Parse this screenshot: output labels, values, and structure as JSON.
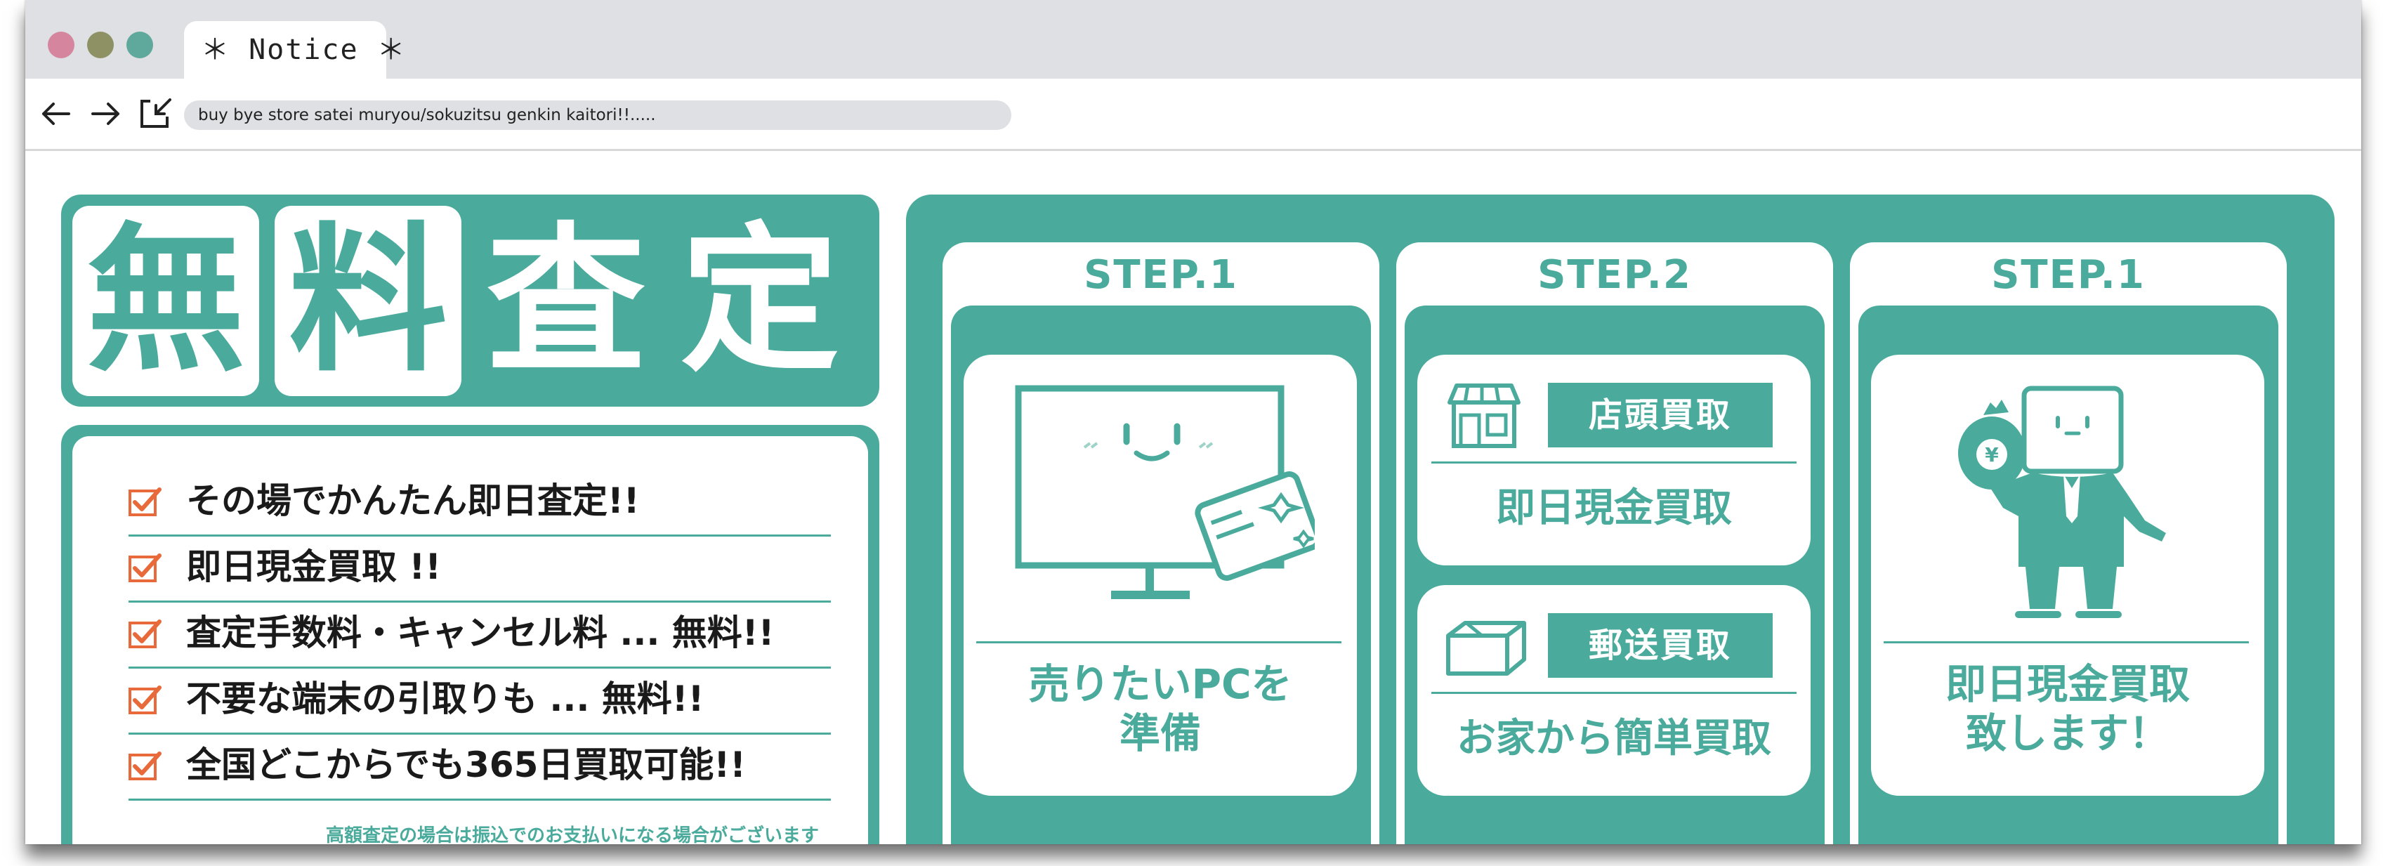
{
  "browser": {
    "tab_title": "＊ Notice ＊",
    "url": "buy bye store satei muryou/sokuzitsu genkin kaitori!!.....",
    "window_dots": [
      "#d5869e",
      "#8d9164",
      "#5fa89c"
    ]
  },
  "colors": {
    "accent": "#4aab9c",
    "check": "#e86a3a",
    "text": "#1a1a1a"
  },
  "hero": {
    "chars": [
      "無",
      "料",
      "査",
      "定"
    ]
  },
  "features": {
    "items": [
      "その場でかんたん即日査定!!",
      "即日現金買取 !!",
      "査定手数料・キャンセル料 ... 無料!!",
      "不要な端末の引取りも ... 無料!!",
      "全国どこからでも365日買取可能!!"
    ],
    "footnote": "高額査定の場合は振込でのお支払いになる場合がございます"
  },
  "steps": [
    {
      "label": "STEP.1",
      "caption_line1": "売りたいPCを",
      "caption_line2": "準備"
    },
    {
      "label": "STEP.2",
      "store": {
        "tag": "店頭買取",
        "caption": "即日現金買取"
      },
      "mail": {
        "tag": "郵送買取",
        "caption": "お家から簡単買取"
      }
    },
    {
      "label": "STEP.1",
      "caption_line1": "即日現金買取",
      "caption_line2": "致します！"
    }
  ]
}
